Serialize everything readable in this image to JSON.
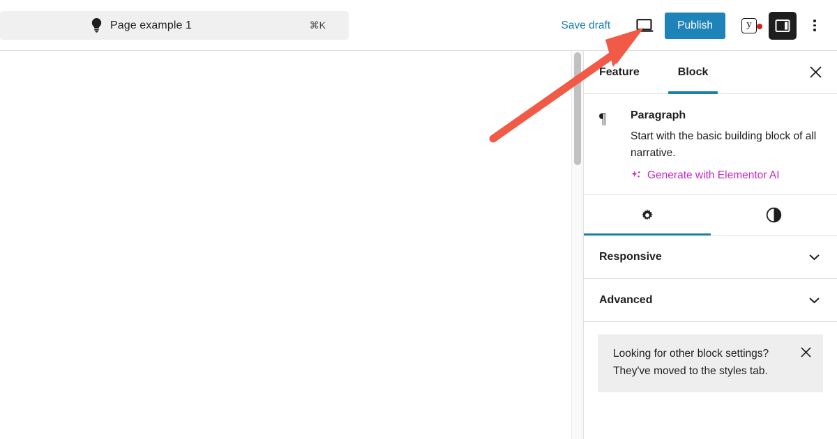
{
  "header": {
    "command_bar": {
      "icon": "lightbulb-icon",
      "title": "Page example 1",
      "shortcut": "⌘K"
    },
    "save_draft_label": "Save draft",
    "preview_icon": "laptop-preview-icon",
    "publish_label": "Publish",
    "yoast": {
      "icon_letter": "y",
      "has_notification_dot": true
    },
    "sidebar_toggle_icon": "sidebar-panel-icon",
    "more_menu_icon": "three-dots-vertical-icon"
  },
  "panel": {
    "tabs": [
      {
        "label": "Feature",
        "active": false
      },
      {
        "label": "Block",
        "active": true
      }
    ],
    "close_icon": "close-icon",
    "block": {
      "icon": "paragraph-pilcrow-icon",
      "icon_glyph": "¶",
      "title": "Paragraph",
      "description": "Start with the basic building block of all narrative.",
      "ai_link_label": "Generate with Elementor AI",
      "ai_link_icon": "sparkle-icon",
      "ai_link_color": "#c726c7"
    },
    "icon_tabs": [
      {
        "name": "settings-tab",
        "icon": "gear-icon",
        "active": true
      },
      {
        "name": "styles-tab",
        "icon": "contrast-half-circle-icon",
        "active": false
      }
    ],
    "accordions": [
      {
        "label": "Responsive",
        "icon": "chevron-down-icon",
        "expanded": false
      },
      {
        "label": "Advanced",
        "icon": "chevron-down-icon",
        "expanded": false
      }
    ],
    "notice": {
      "text": "Looking for other block settings? They've moved to the styles tab.",
      "close_icon": "close-icon",
      "background": "#eeeeee"
    }
  },
  "annotation": {
    "arrow_color": "#f05a46",
    "points_to": "laptop-preview-icon"
  },
  "colors": {
    "publish_button": "#1e83b8",
    "link": "#1c7fb0",
    "tab_underline": "#1b7fa8",
    "command_bar_bg": "#f0f0f0"
  }
}
